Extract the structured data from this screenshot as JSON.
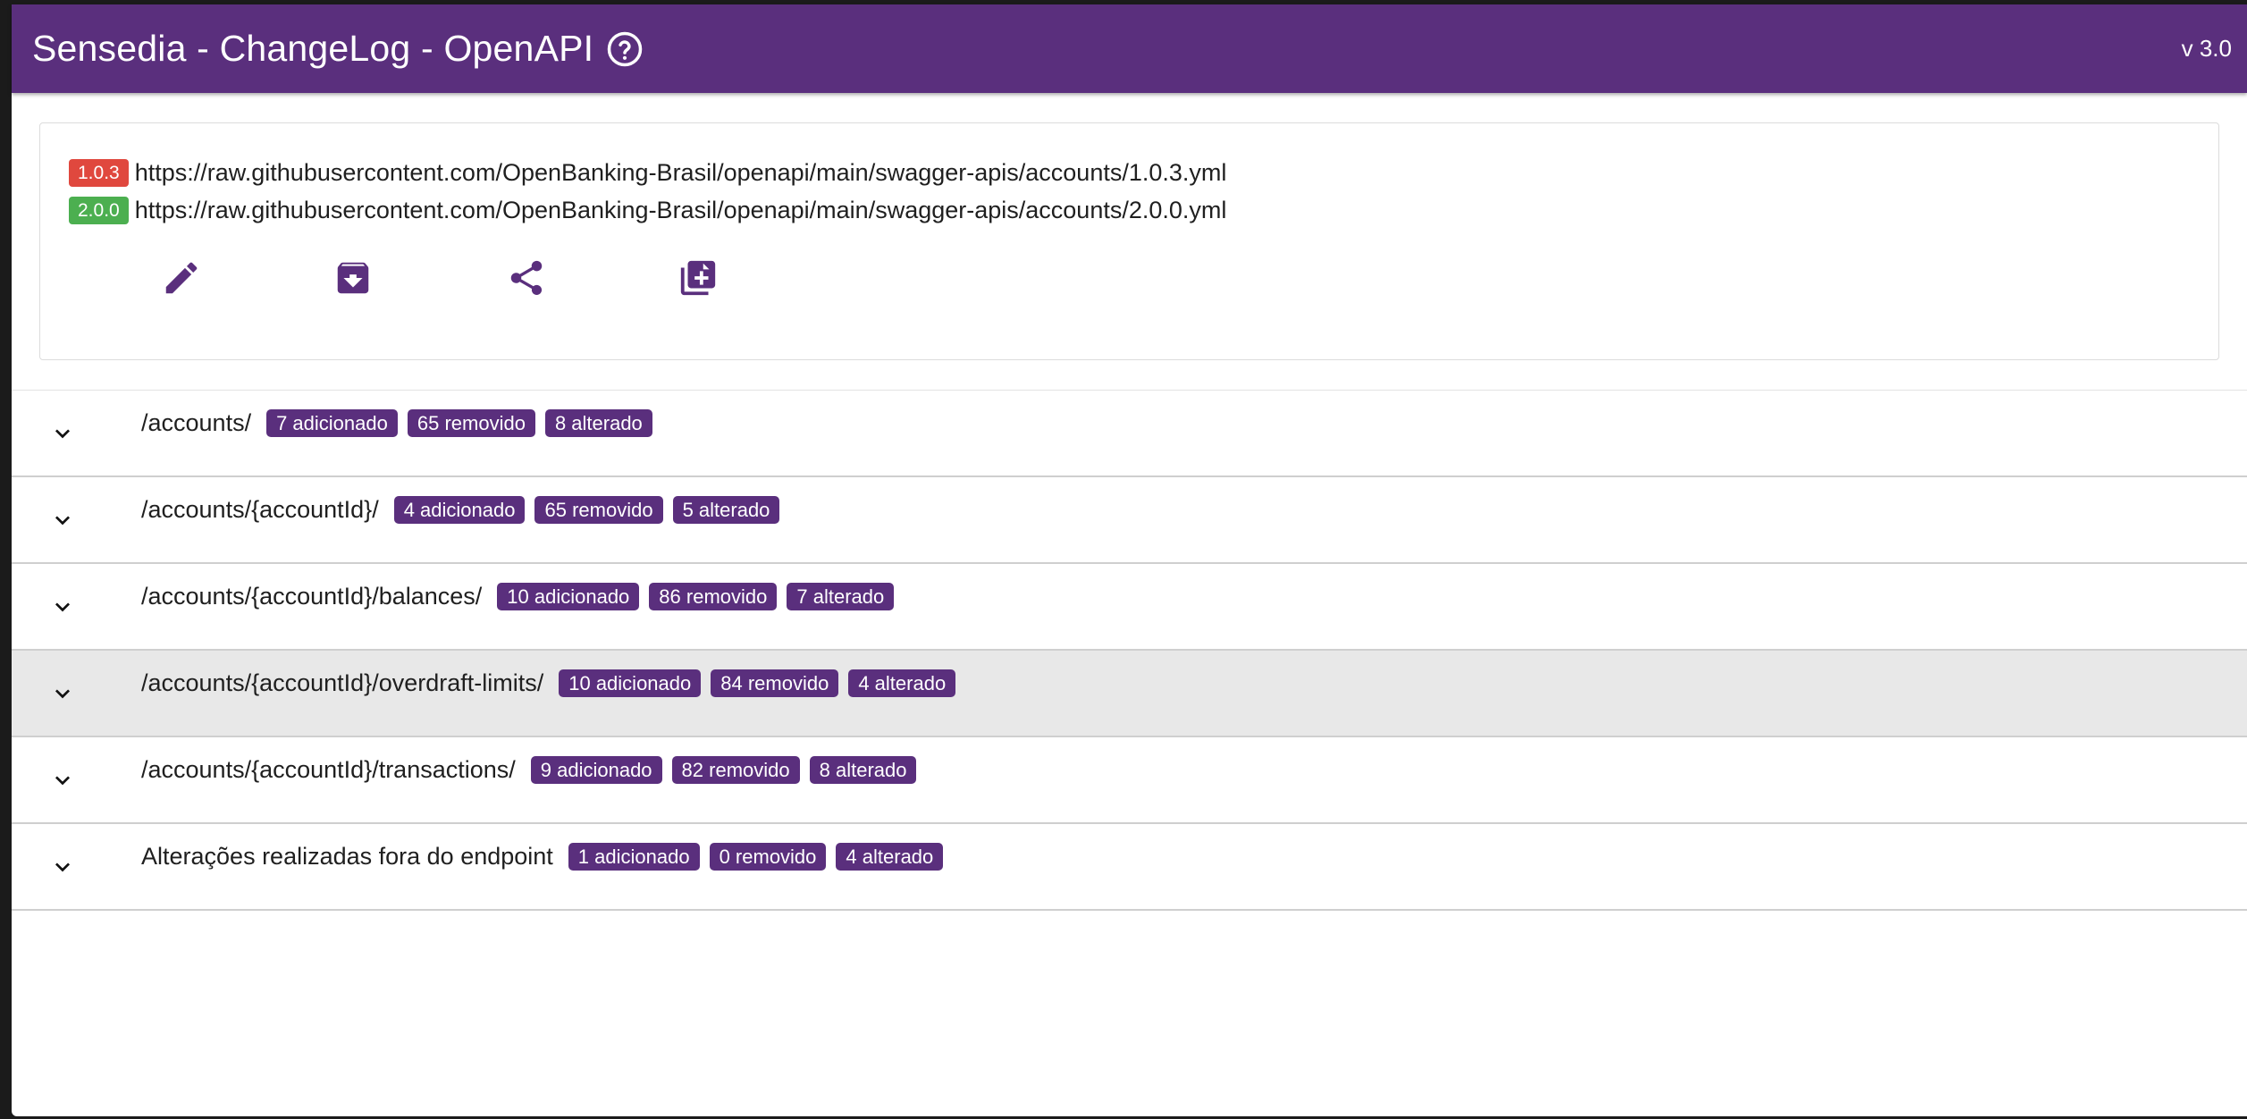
{
  "header": {
    "title": "Sensedia - ChangeLog - OpenAPI",
    "version": "v 3.0",
    "color": "#5a2f7d"
  },
  "specs": [
    {
      "version": "1.0.3",
      "url": "https://raw.githubusercontent.com/OpenBanking-Brasil/openapi/main/swagger-apis/accounts/1.0.3.yml",
      "color": "#e0483e"
    },
    {
      "version": "2.0.0",
      "url": "https://raw.githubusercontent.com/OpenBanking-Brasil/openapi/main/swagger-apis/accounts/2.0.0.yml",
      "color": "#4caf50"
    }
  ],
  "actions": [
    {
      "name": "edit-icon"
    },
    {
      "name": "archive-download-icon"
    },
    {
      "name": "share-icon"
    },
    {
      "name": "copy-document-icon"
    }
  ],
  "endpoints": [
    {
      "path": "/accounts/",
      "added": "7 adicionado",
      "removed": "65 removido",
      "changed": "8 alterado"
    },
    {
      "path": "/accounts/{accountId}/",
      "added": "4 adicionado",
      "removed": "65 removido",
      "changed": "5 alterado"
    },
    {
      "path": "/accounts/{accountId}/balances/",
      "added": "10 adicionado",
      "removed": "86 removido",
      "changed": "7 alterado"
    },
    {
      "path": "/accounts/{accountId}/overdraft-limits/",
      "added": "10 adicionado",
      "removed": "84 removido",
      "changed": "4 alterado"
    },
    {
      "path": "/accounts/{accountId}/transactions/",
      "added": "9 adicionado",
      "removed": "82 removido",
      "changed": "8 alterado"
    },
    {
      "path": "Alterações realizadas fora do endpoint",
      "added": "1 adicionado",
      "removed": "0 removido",
      "changed": "4 alterado"
    }
  ]
}
